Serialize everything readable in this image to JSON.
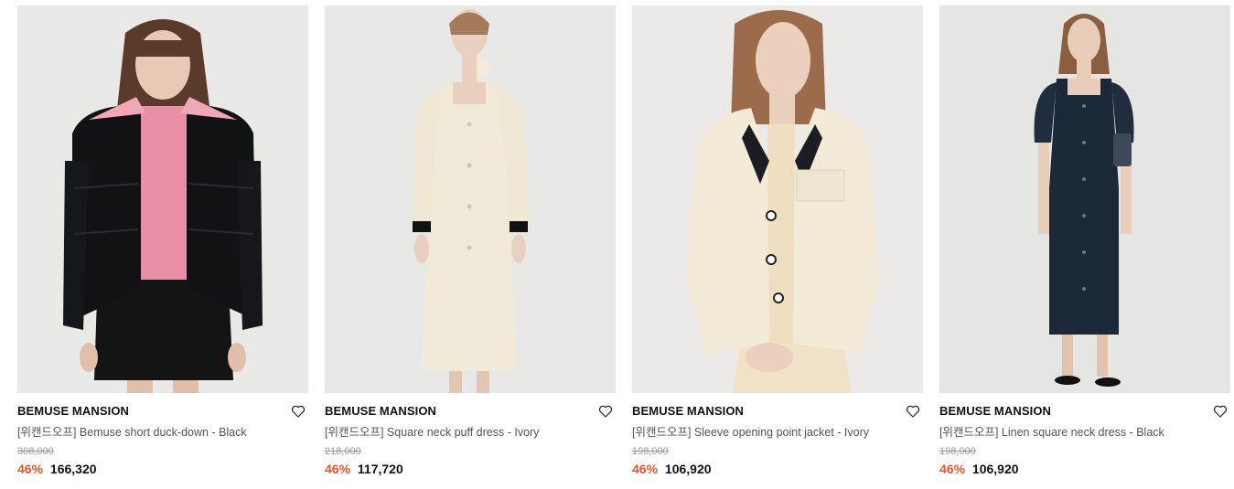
{
  "colors": {
    "discount": "#e8572c",
    "original_price": "#999999",
    "brand": "#111111"
  },
  "products": [
    {
      "image_desc": "woman in black puffer jacket over pink knit",
      "brand": "BEMUSE MANSION",
      "name": "[위캔드오프] Bemuse short duck-down - Black",
      "original_price": "308,000",
      "discount": "46%",
      "price": "166,320",
      "wishlist_icon": "heart-outline-icon"
    },
    {
      "image_desc": "woman in ivory square neck puff dress",
      "brand": "BEMUSE MANSION",
      "name": "[위캔드오프] Square neck puff dress - Ivory",
      "original_price": "218,000",
      "discount": "46%",
      "price": "117,720",
      "wishlist_icon": "heart-outline-icon"
    },
    {
      "image_desc": "woman in ivory cropped jacket",
      "brand": "BEMUSE MANSION",
      "name": "[위캔드오프] Sleeve opening point jacket - Ivory",
      "original_price": "198,000",
      "discount": "46%",
      "price": "106,920",
      "wishlist_icon": "heart-outline-icon"
    },
    {
      "image_desc": "woman in navy linen square neck dress",
      "brand": "BEMUSE MANSION",
      "name": "[위캔드오프] Linen square neck dress - Black",
      "original_price": "198,000",
      "discount": "46%",
      "price": "106,920",
      "wishlist_icon": "heart-outline-icon"
    }
  ]
}
